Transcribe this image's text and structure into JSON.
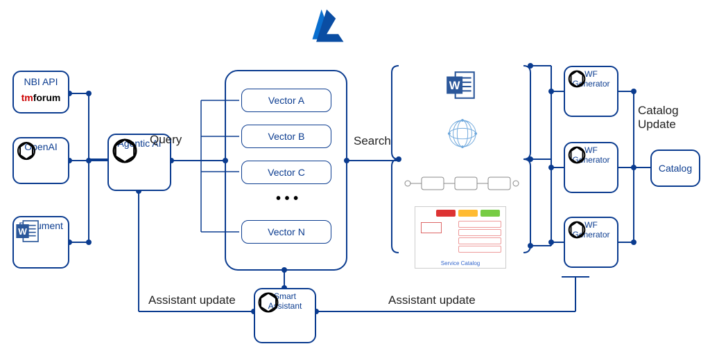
{
  "top": {
    "azure": "Azure"
  },
  "left": {
    "nbi": {
      "title": "NBI API",
      "tm": "tm",
      "forum": "forum"
    },
    "openai": "OpenAI",
    "document": "Document"
  },
  "agent": {
    "title": "Agentic AI"
  },
  "vectors": {
    "items": [
      "Vector A",
      "Vector B",
      "Vector C",
      "Vector N"
    ],
    "ellipsis": "• • •"
  },
  "smart": {
    "title": "Smart\nAssistant"
  },
  "wf": {
    "title": "WF\nGenerator"
  },
  "catalog": {
    "title": "Catalog"
  },
  "edges": {
    "query": "Query",
    "search": "Search",
    "assistant_update_left": "Assistant update",
    "assistant_update_right": "Assistant update",
    "catalog_update": "Catalog\nUpdate"
  },
  "resources": {
    "service_catalog_caption": "Service Catalog"
  }
}
